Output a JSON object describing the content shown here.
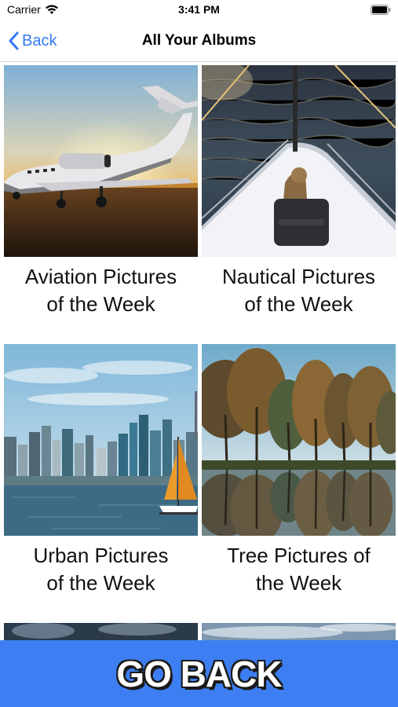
{
  "status_bar": {
    "carrier": "Carrier",
    "time": "3:41 PM",
    "icons": [
      "wifi-icon",
      "battery-icon"
    ]
  },
  "nav": {
    "back_label": "Back",
    "title": "All Your Albums",
    "accent_color": "#3478f6"
  },
  "albums": [
    {
      "title_line1": "Aviation Pictures",
      "title_line2": "of the Week",
      "image": "private jet at sunset on runway"
    },
    {
      "title_line1": "Nautical Pictures",
      "title_line2": "of the Week",
      "image": "bow of a sailboat on the water with a dog"
    },
    {
      "title_line1": "Urban Pictures",
      "title_line2": "of the Week",
      "image": "city skyline across water with sailboat"
    },
    {
      "title_line1": "Tree Pictures of",
      "title_line2": "the Week",
      "image": "autumn trees reflected in a lake"
    }
  ],
  "footer": {
    "go_back_label": "GO BACK",
    "background_color": "#3d7ff2"
  }
}
